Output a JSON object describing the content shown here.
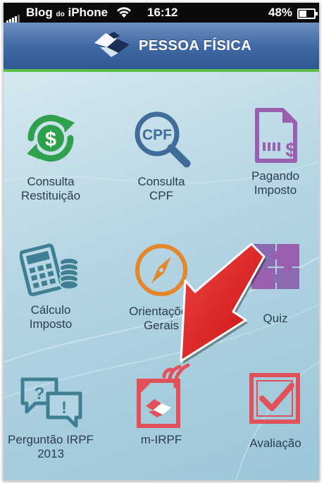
{
  "status_bar": {
    "carrier": "Blog",
    "carrier_small": "do",
    "carrier_end": "iPhone",
    "time": "16:12",
    "battery": "48%"
  },
  "header": {
    "title": "PESSOA FÍSICA"
  },
  "tiles": [
    {
      "label_line1": "Consulta",
      "label_line2": "Restituição",
      "icon": "refund-dollar-icon"
    },
    {
      "label_line1": "Consulta",
      "label_line2": "CPF",
      "icon": "cpf-magnifier-icon",
      "icon_text": "CPF"
    },
    {
      "label_line1": "Pagando",
      "label_line2": "Imposto",
      "icon": "payment-document-icon",
      "icon_text": "$"
    },
    {
      "label_line1": "Cálculo",
      "label_line2": "Imposto",
      "icon": "calculator-coins-icon"
    },
    {
      "label_line1": "Orientações",
      "label_line2": "Gerais",
      "icon": "compass-icon"
    },
    {
      "label_line1": "Quiz",
      "label_line2": "",
      "icon": "puzzle-icon"
    },
    {
      "label_line1": "Perguntão IRPF",
      "label_line2": "2013",
      "icon": "question-exclamation-bubbles-icon",
      "icon_text_q": "?",
      "icon_text_e": "!"
    },
    {
      "label_line1": "m-IRPF",
      "label_line2": "",
      "icon": "mobile-irpf-icon"
    },
    {
      "label_line1": "Avaliação",
      "label_line2": "",
      "icon": "checkbox-check-icon"
    }
  ],
  "colors": {
    "green": "#2fa04b",
    "blue": "#3f6c98",
    "purple": "#9a5fae",
    "teal": "#3e7f94",
    "orange": "#e4862c",
    "red": "#e2505a",
    "arrow": "#e41e1e",
    "header_accent": "#5ac04a"
  }
}
